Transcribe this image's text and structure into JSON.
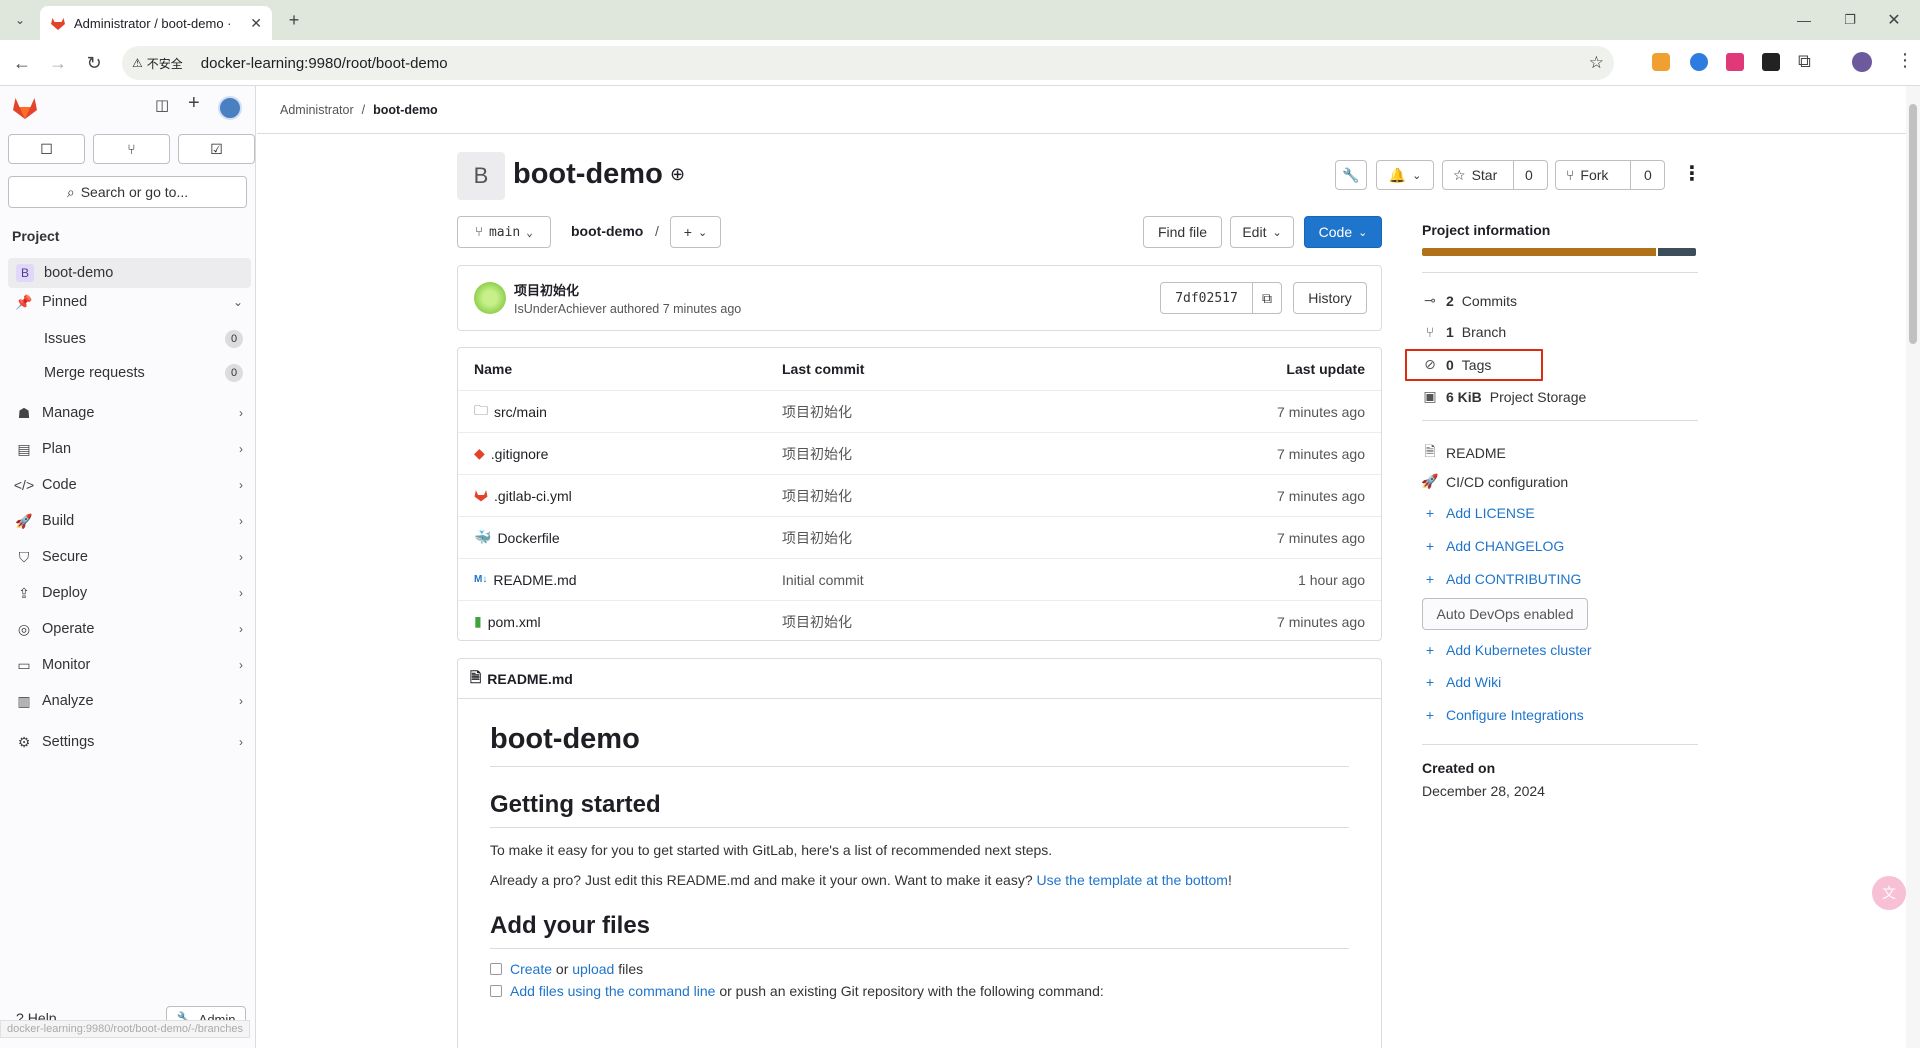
{
  "browser": {
    "tab_title": "Administrator / boot-demo · ",
    "security_label": "不安全",
    "url": "docker-learning:9980/root/boot-demo"
  },
  "sidebar": {
    "search_placeholder": "Search or go to...",
    "section_title": "Project",
    "project": {
      "badge": "B",
      "name": "boot-demo"
    },
    "pinned": "Pinned",
    "pinned_items": [
      {
        "label": "Issues",
        "count": "0"
      },
      {
        "label": "Merge requests",
        "count": "0"
      }
    ],
    "items": [
      {
        "label": "Manage"
      },
      {
        "label": "Plan"
      },
      {
        "label": "Code"
      },
      {
        "label": "Build"
      },
      {
        "label": "Secure"
      },
      {
        "label": "Deploy"
      },
      {
        "label": "Operate"
      },
      {
        "label": "Monitor"
      },
      {
        "label": "Analyze"
      },
      {
        "label": "Settings"
      }
    ],
    "help": "Help",
    "admin": "Admin"
  },
  "breadcrumb": {
    "parent": "Administrator",
    "sep": "/",
    "current": "boot-demo"
  },
  "project": {
    "avatar": "B",
    "name": "boot-demo",
    "star_label": "Star",
    "star_count": "0",
    "fork_label": "Fork",
    "fork_count": "0"
  },
  "toolbar": {
    "branch": "main",
    "path": "boot-demo",
    "path_sep": "/",
    "find_file": "Find file",
    "edit": "Edit",
    "code": "Code"
  },
  "commit": {
    "title": "项目初始化",
    "author": "IsUnderAchiever",
    "meta": " authored 7 minutes ago",
    "sha": "7df02517",
    "history": "History"
  },
  "files": {
    "headers": {
      "name": "Name",
      "last_commit": "Last commit",
      "last_update": "Last update"
    },
    "rows": [
      {
        "name": "src/main",
        "commit": "项目初始化",
        "updated": "7 minutes ago",
        "icon": "folder-icon"
      },
      {
        "name": ".gitignore",
        "commit": "项目初始化",
        "updated": "7 minutes ago",
        "icon": "git-icon"
      },
      {
        "name": ".gitlab-ci.yml",
        "commit": "项目初始化",
        "updated": "7 minutes ago",
        "icon": "gitlab-icon"
      },
      {
        "name": "Dockerfile",
        "commit": "项目初始化",
        "updated": "7 minutes ago",
        "icon": "docker-icon"
      },
      {
        "name": "README.md",
        "commit": "Initial commit",
        "updated": "1 hour ago",
        "icon": "markdown-icon"
      },
      {
        "name": "pom.xml",
        "commit": "项目初始化",
        "updated": "7 minutes ago",
        "icon": "xml-file-icon"
      }
    ]
  },
  "readme": {
    "filename": "README.md",
    "h1": "boot-demo",
    "h2_started": "Getting started",
    "p1": "To make it easy for you to get started with GitLab, here's a list of recommended next steps.",
    "p2_text": "Already a pro? Just edit this README.md and make it your own. Want to make it easy? ",
    "p2_link": "Use the template at the bottom",
    "p2_end": "!",
    "h2_files": "Add your files",
    "cb1_a": "Create",
    "cb1_or": " or ",
    "cb1_b": "upload",
    "cb1_end": " files",
    "cb2_link": "Add files using the command line",
    "cb2_text": " or push an existing Git repository with the following command:"
  },
  "info": {
    "title": "Project information",
    "commits_n": "2",
    "commits_label": "Commits",
    "branch_n": "1",
    "branch_label": "Branch",
    "tags_n": "0",
    "tags_label": "Tags",
    "storage_n": "6 KiB",
    "storage_label": "Project Storage",
    "readme": "README",
    "cicd": "CI/CD configuration",
    "add_license": "Add LICENSE",
    "add_changelog": "Add CHANGELOG",
    "add_contributing": "Add CONTRIBUTING",
    "autodevops": "Auto DevOps enabled",
    "add_k8s": "Add Kubernetes cluster",
    "add_wiki": "Add Wiki",
    "configure": "Configure Integrations",
    "created_label": "Created on",
    "created_date": "December 28, 2024"
  },
  "status_url": "docker-learning:9980/root/boot-demo/-/branches",
  "colors": {
    "accent": "#1f75cb",
    "highlight": "#dd2b0e",
    "lang_java": "#b07219",
    "lang_other": "#3e4d5a"
  }
}
